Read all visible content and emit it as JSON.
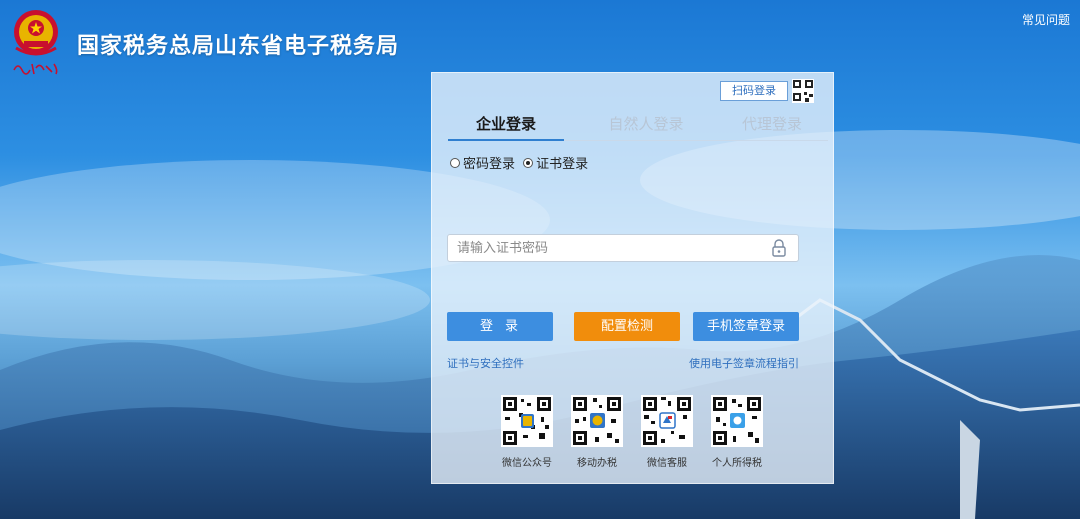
{
  "header": {
    "site_title": "国家税务总局山东省电子税务局",
    "faq_label": "常见问题"
  },
  "panel": {
    "scan_login_label": "扫码登录",
    "tabs": [
      {
        "label": "企业登录",
        "active": true
      },
      {
        "label": "自然人登录",
        "active": false
      },
      {
        "label": "代理登录",
        "active": false
      }
    ],
    "radios": [
      {
        "label": "密码登录",
        "checked": false
      },
      {
        "label": "证书登录",
        "checked": true
      }
    ],
    "password_placeholder": "请输入证书密码",
    "password_value": "",
    "buttons": {
      "login": "登录",
      "config_check": "配置检测",
      "phone_sign_login": "手机签章登录"
    },
    "links": {
      "cert_controls": "证书与安全控件",
      "esign_guide": "使用电子签章流程指引"
    },
    "qr_codes": [
      {
        "label": "微信公众号"
      },
      {
        "label": "移动办税"
      },
      {
        "label": "微信客服"
      },
      {
        "label": "个人所得税"
      }
    ]
  },
  "colors": {
    "primary_button": "#3d8ee0",
    "orange_button": "#f18d0c",
    "link": "#2f6fbe",
    "active_tab_underline": "#2f7fd0"
  }
}
